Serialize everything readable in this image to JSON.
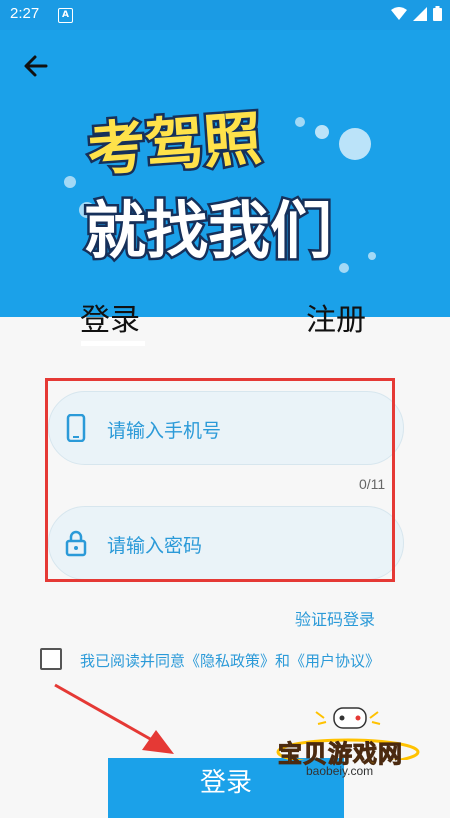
{
  "status_bar": {
    "time": "2:27",
    "badge_letter": "A"
  },
  "header": {
    "banner_line1": "考驾照",
    "banner_line2": "就找我们"
  },
  "tabs": [
    {
      "label": "登录",
      "active": true
    },
    {
      "label": "注册",
      "active": false
    }
  ],
  "form": {
    "phone_placeholder": "请输入手机号",
    "phone_counter": "0/11",
    "password_placeholder": "请输入密码",
    "sms_login_link": "验证码登录",
    "agreement_text": "我已阅读并同意《隐私政策》和《用户协议》",
    "agreement_checked": false,
    "submit_label": "登录"
  },
  "watermark": {
    "title": "宝贝游戏网",
    "url": "baobeiy.com"
  },
  "colors": {
    "primary": "#1ba1e9",
    "link": "#2b9ad8",
    "highlight": "#e53935"
  }
}
